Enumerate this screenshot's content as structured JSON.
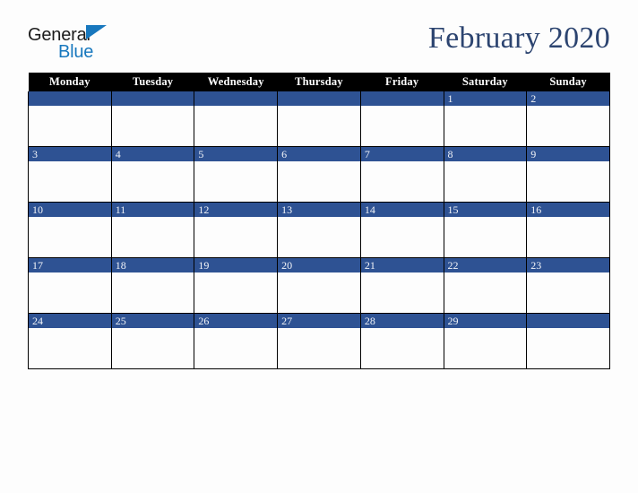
{
  "brand": {
    "name_top": "General",
    "name_bottom": "Blue",
    "triangle_icon": "triangle-icon",
    "color_dark": "#1b1b1b",
    "color_blue": "#1878be"
  },
  "header": {
    "title": "February 2020",
    "title_color": "#2c4470"
  },
  "calendar": {
    "month": "February",
    "year": "2020",
    "header_bg": "#000000",
    "header_text_color": "#ffffff",
    "daynum_bg": "#2e5293",
    "daynum_text_color": "#f2f4f8",
    "grid_line_color": "#000000",
    "cell_bg": "#fdfdfd",
    "weekdays": [
      "Monday",
      "Tuesday",
      "Wednesday",
      "Thursday",
      "Friday",
      "Saturday",
      "Sunday"
    ],
    "weeks": [
      [
        "",
        "",
        "",
        "",
        "",
        "1",
        "2"
      ],
      [
        "3",
        "4",
        "5",
        "6",
        "7",
        "8",
        "9"
      ],
      [
        "10",
        "11",
        "12",
        "13",
        "14",
        "15",
        "16"
      ],
      [
        "17",
        "18",
        "19",
        "20",
        "21",
        "22",
        "23"
      ],
      [
        "24",
        "25",
        "26",
        "27",
        "28",
        "29",
        ""
      ]
    ]
  }
}
